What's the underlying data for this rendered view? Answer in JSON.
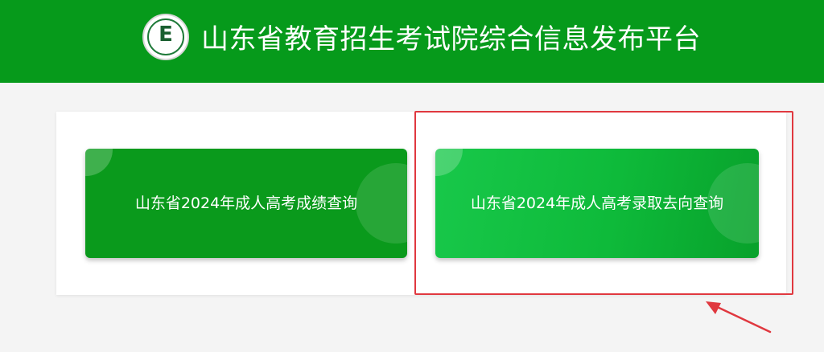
{
  "header": {
    "title": "山东省教育招生考试院综合信息发布平台",
    "logo_letter": "E",
    "background": "#069a1b"
  },
  "buttons": [
    {
      "label": "山东省2024年成人高考成绩查询",
      "color": "#0a9a1c"
    },
    {
      "label": "山东省2024年成人高考录取去向查询",
      "color": "#18c84a"
    }
  ],
  "annotation": {
    "color": "#e0383f",
    "target": "buttons.1",
    "shape": "rectangle-with-arrow"
  }
}
